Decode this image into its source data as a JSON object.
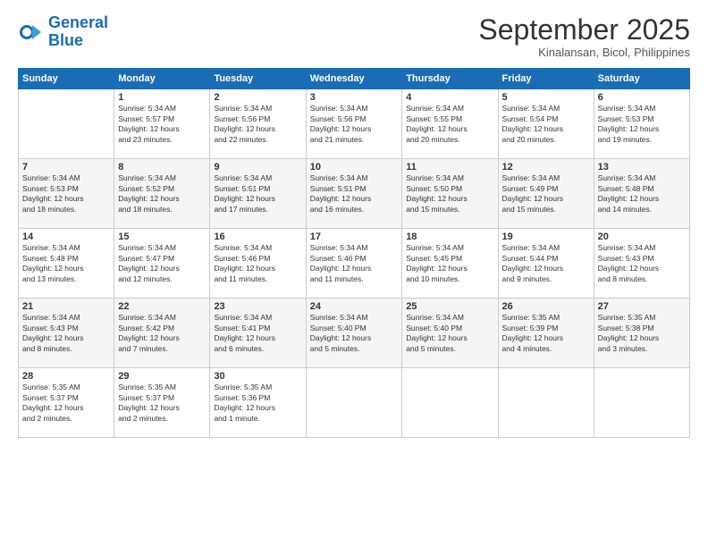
{
  "logo": {
    "line1": "General",
    "line2": "Blue"
  },
  "title": "September 2025",
  "subtitle": "Kinalansan, Bicol, Philippines",
  "weekdays": [
    "Sunday",
    "Monday",
    "Tuesday",
    "Wednesday",
    "Thursday",
    "Friday",
    "Saturday"
  ],
  "weeks": [
    [
      {
        "day": "",
        "info": ""
      },
      {
        "day": "1",
        "info": "Sunrise: 5:34 AM\nSunset: 5:57 PM\nDaylight: 12 hours\nand 23 minutes."
      },
      {
        "day": "2",
        "info": "Sunrise: 5:34 AM\nSunset: 5:56 PM\nDaylight: 12 hours\nand 22 minutes."
      },
      {
        "day": "3",
        "info": "Sunrise: 5:34 AM\nSunset: 5:56 PM\nDaylight: 12 hours\nand 21 minutes."
      },
      {
        "day": "4",
        "info": "Sunrise: 5:34 AM\nSunset: 5:55 PM\nDaylight: 12 hours\nand 20 minutes."
      },
      {
        "day": "5",
        "info": "Sunrise: 5:34 AM\nSunset: 5:54 PM\nDaylight: 12 hours\nand 20 minutes."
      },
      {
        "day": "6",
        "info": "Sunrise: 5:34 AM\nSunset: 5:53 PM\nDaylight: 12 hours\nand 19 minutes."
      }
    ],
    [
      {
        "day": "7",
        "info": "Sunrise: 5:34 AM\nSunset: 5:53 PM\nDaylight: 12 hours\nand 18 minutes."
      },
      {
        "day": "8",
        "info": "Sunrise: 5:34 AM\nSunset: 5:52 PM\nDaylight: 12 hours\nand 18 minutes."
      },
      {
        "day": "9",
        "info": "Sunrise: 5:34 AM\nSunset: 5:51 PM\nDaylight: 12 hours\nand 17 minutes."
      },
      {
        "day": "10",
        "info": "Sunrise: 5:34 AM\nSunset: 5:51 PM\nDaylight: 12 hours\nand 16 minutes."
      },
      {
        "day": "11",
        "info": "Sunrise: 5:34 AM\nSunset: 5:50 PM\nDaylight: 12 hours\nand 15 minutes."
      },
      {
        "day": "12",
        "info": "Sunrise: 5:34 AM\nSunset: 5:49 PM\nDaylight: 12 hours\nand 15 minutes."
      },
      {
        "day": "13",
        "info": "Sunrise: 5:34 AM\nSunset: 5:48 PM\nDaylight: 12 hours\nand 14 minutes."
      }
    ],
    [
      {
        "day": "14",
        "info": "Sunrise: 5:34 AM\nSunset: 5:48 PM\nDaylight: 12 hours\nand 13 minutes."
      },
      {
        "day": "15",
        "info": "Sunrise: 5:34 AM\nSunset: 5:47 PM\nDaylight: 12 hours\nand 12 minutes."
      },
      {
        "day": "16",
        "info": "Sunrise: 5:34 AM\nSunset: 5:46 PM\nDaylight: 12 hours\nand 11 minutes."
      },
      {
        "day": "17",
        "info": "Sunrise: 5:34 AM\nSunset: 5:46 PM\nDaylight: 12 hours\nand 11 minutes."
      },
      {
        "day": "18",
        "info": "Sunrise: 5:34 AM\nSunset: 5:45 PM\nDaylight: 12 hours\nand 10 minutes."
      },
      {
        "day": "19",
        "info": "Sunrise: 5:34 AM\nSunset: 5:44 PM\nDaylight: 12 hours\nand 9 minutes."
      },
      {
        "day": "20",
        "info": "Sunrise: 5:34 AM\nSunset: 5:43 PM\nDaylight: 12 hours\nand 8 minutes."
      }
    ],
    [
      {
        "day": "21",
        "info": "Sunrise: 5:34 AM\nSunset: 5:43 PM\nDaylight: 12 hours\nand 8 minutes."
      },
      {
        "day": "22",
        "info": "Sunrise: 5:34 AM\nSunset: 5:42 PM\nDaylight: 12 hours\nand 7 minutes."
      },
      {
        "day": "23",
        "info": "Sunrise: 5:34 AM\nSunset: 5:41 PM\nDaylight: 12 hours\nand 6 minutes."
      },
      {
        "day": "24",
        "info": "Sunrise: 5:34 AM\nSunset: 5:40 PM\nDaylight: 12 hours\nand 5 minutes."
      },
      {
        "day": "25",
        "info": "Sunrise: 5:34 AM\nSunset: 5:40 PM\nDaylight: 12 hours\nand 5 minutes."
      },
      {
        "day": "26",
        "info": "Sunrise: 5:35 AM\nSunset: 5:39 PM\nDaylight: 12 hours\nand 4 minutes."
      },
      {
        "day": "27",
        "info": "Sunrise: 5:35 AM\nSunset: 5:38 PM\nDaylight: 12 hours\nand 3 minutes."
      }
    ],
    [
      {
        "day": "28",
        "info": "Sunrise: 5:35 AM\nSunset: 5:37 PM\nDaylight: 12 hours\nand 2 minutes."
      },
      {
        "day": "29",
        "info": "Sunrise: 5:35 AM\nSunset: 5:37 PM\nDaylight: 12 hours\nand 2 minutes."
      },
      {
        "day": "30",
        "info": "Sunrise: 5:35 AM\nSunset: 5:36 PM\nDaylight: 12 hours\nand 1 minute."
      },
      {
        "day": "",
        "info": ""
      },
      {
        "day": "",
        "info": ""
      },
      {
        "day": "",
        "info": ""
      },
      {
        "day": "",
        "info": ""
      }
    ]
  ]
}
